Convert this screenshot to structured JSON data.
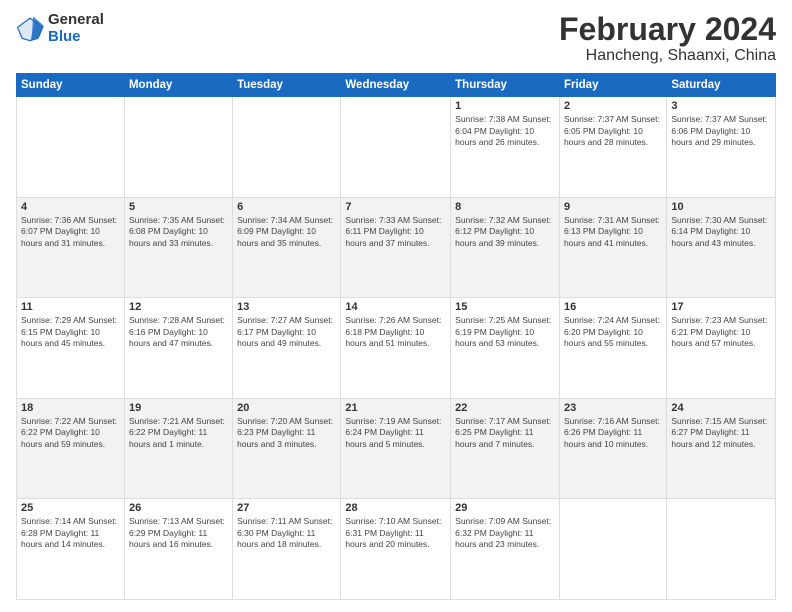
{
  "logo": {
    "general": "General",
    "blue": "Blue"
  },
  "header": {
    "month": "February 2024",
    "location": "Hancheng, Shaanxi, China"
  },
  "weekdays": [
    "Sunday",
    "Monday",
    "Tuesday",
    "Wednesday",
    "Thursday",
    "Friday",
    "Saturday"
  ],
  "weeks": [
    [
      {
        "day": "",
        "info": ""
      },
      {
        "day": "",
        "info": ""
      },
      {
        "day": "",
        "info": ""
      },
      {
        "day": "",
        "info": ""
      },
      {
        "day": "1",
        "info": "Sunrise: 7:38 AM\nSunset: 6:04 PM\nDaylight: 10 hours and 26 minutes."
      },
      {
        "day": "2",
        "info": "Sunrise: 7:37 AM\nSunset: 6:05 PM\nDaylight: 10 hours and 28 minutes."
      },
      {
        "day": "3",
        "info": "Sunrise: 7:37 AM\nSunset: 6:06 PM\nDaylight: 10 hours and 29 minutes."
      }
    ],
    [
      {
        "day": "4",
        "info": "Sunrise: 7:36 AM\nSunset: 6:07 PM\nDaylight: 10 hours and 31 minutes."
      },
      {
        "day": "5",
        "info": "Sunrise: 7:35 AM\nSunset: 6:08 PM\nDaylight: 10 hours and 33 minutes."
      },
      {
        "day": "6",
        "info": "Sunrise: 7:34 AM\nSunset: 6:09 PM\nDaylight: 10 hours and 35 minutes."
      },
      {
        "day": "7",
        "info": "Sunrise: 7:33 AM\nSunset: 6:11 PM\nDaylight: 10 hours and 37 minutes."
      },
      {
        "day": "8",
        "info": "Sunrise: 7:32 AM\nSunset: 6:12 PM\nDaylight: 10 hours and 39 minutes."
      },
      {
        "day": "9",
        "info": "Sunrise: 7:31 AM\nSunset: 6:13 PM\nDaylight: 10 hours and 41 minutes."
      },
      {
        "day": "10",
        "info": "Sunrise: 7:30 AM\nSunset: 6:14 PM\nDaylight: 10 hours and 43 minutes."
      }
    ],
    [
      {
        "day": "11",
        "info": "Sunrise: 7:29 AM\nSunset: 6:15 PM\nDaylight: 10 hours and 45 minutes."
      },
      {
        "day": "12",
        "info": "Sunrise: 7:28 AM\nSunset: 6:16 PM\nDaylight: 10 hours and 47 minutes."
      },
      {
        "day": "13",
        "info": "Sunrise: 7:27 AM\nSunset: 6:17 PM\nDaylight: 10 hours and 49 minutes."
      },
      {
        "day": "14",
        "info": "Sunrise: 7:26 AM\nSunset: 6:18 PM\nDaylight: 10 hours and 51 minutes."
      },
      {
        "day": "15",
        "info": "Sunrise: 7:25 AM\nSunset: 6:19 PM\nDaylight: 10 hours and 53 minutes."
      },
      {
        "day": "16",
        "info": "Sunrise: 7:24 AM\nSunset: 6:20 PM\nDaylight: 10 hours and 55 minutes."
      },
      {
        "day": "17",
        "info": "Sunrise: 7:23 AM\nSunset: 6:21 PM\nDaylight: 10 hours and 57 minutes."
      }
    ],
    [
      {
        "day": "18",
        "info": "Sunrise: 7:22 AM\nSunset: 6:22 PM\nDaylight: 10 hours and 59 minutes."
      },
      {
        "day": "19",
        "info": "Sunrise: 7:21 AM\nSunset: 6:22 PM\nDaylight: 11 hours and 1 minute."
      },
      {
        "day": "20",
        "info": "Sunrise: 7:20 AM\nSunset: 6:23 PM\nDaylight: 11 hours and 3 minutes."
      },
      {
        "day": "21",
        "info": "Sunrise: 7:19 AM\nSunset: 6:24 PM\nDaylight: 11 hours and 5 minutes."
      },
      {
        "day": "22",
        "info": "Sunrise: 7:17 AM\nSunset: 6:25 PM\nDaylight: 11 hours and 7 minutes."
      },
      {
        "day": "23",
        "info": "Sunrise: 7:16 AM\nSunset: 6:26 PM\nDaylight: 11 hours and 10 minutes."
      },
      {
        "day": "24",
        "info": "Sunrise: 7:15 AM\nSunset: 6:27 PM\nDaylight: 11 hours and 12 minutes."
      }
    ],
    [
      {
        "day": "25",
        "info": "Sunrise: 7:14 AM\nSunset: 6:28 PM\nDaylight: 11 hours and 14 minutes."
      },
      {
        "day": "26",
        "info": "Sunrise: 7:13 AM\nSunset: 6:29 PM\nDaylight: 11 hours and 16 minutes."
      },
      {
        "day": "27",
        "info": "Sunrise: 7:11 AM\nSunset: 6:30 PM\nDaylight: 11 hours and 18 minutes."
      },
      {
        "day": "28",
        "info": "Sunrise: 7:10 AM\nSunset: 6:31 PM\nDaylight: 11 hours and 20 minutes."
      },
      {
        "day": "29",
        "info": "Sunrise: 7:09 AM\nSunset: 6:32 PM\nDaylight: 11 hours and 23 minutes."
      },
      {
        "day": "",
        "info": ""
      },
      {
        "day": "",
        "info": ""
      }
    ]
  ]
}
